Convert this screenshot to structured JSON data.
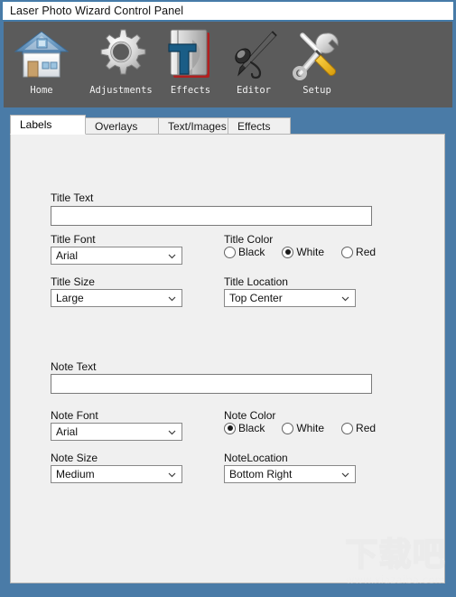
{
  "window": {
    "title": "Laser Photo Wizard Control Panel",
    "accent_border_color": "#4a7ba7",
    "toolbar_bg_color": "#5b5b5b",
    "panel_bg_color": "#f0f0f0"
  },
  "toolbar": {
    "items": [
      {
        "label": "Home",
        "icon": "house-icon"
      },
      {
        "label": "Adjustments",
        "icon": "gear-icon"
      },
      {
        "label": "Effects",
        "icon": "text-book-icon"
      },
      {
        "label": "Editor",
        "icon": "airbrush-icon"
      },
      {
        "label": "Setup",
        "icon": "wrench-screwdriver-icon"
      }
    ]
  },
  "tabs": [
    {
      "label": "Labels",
      "active": true
    },
    {
      "label": "Overlays",
      "active": false
    },
    {
      "label": "Text/Images",
      "active": false
    },
    {
      "label": "Effects",
      "active": false
    }
  ],
  "labels_tab": {
    "title_text": {
      "label": "Title Text",
      "value": "",
      "placeholder": ""
    },
    "title_font": {
      "label": "Title Font",
      "value": "Arial"
    },
    "title_color": {
      "label": "Title Color",
      "options": [
        {
          "label": "Black",
          "selected": false
        },
        {
          "label": "White",
          "selected": true
        },
        {
          "label": "Red",
          "selected": false
        }
      ]
    },
    "title_size": {
      "label": "Title Size",
      "value": "Large"
    },
    "title_location": {
      "label": "Title Location",
      "value": "Top Center"
    },
    "note_text": {
      "label": "Note Text",
      "value": "",
      "placeholder": ""
    },
    "note_font": {
      "label": "Note Font",
      "value": "Arial"
    },
    "note_color": {
      "label": "Note Color",
      "options": [
        {
          "label": "Black",
          "selected": true
        },
        {
          "label": "White",
          "selected": false
        },
        {
          "label": "Red",
          "selected": false
        }
      ]
    },
    "note_size": {
      "label": "Note Size",
      "value": "Medium"
    },
    "note_location": {
      "label": "NoteLocation",
      "value": "Bottom Right"
    }
  },
  "watermark": {
    "chinese": "下载吧",
    "url": "www.xiazaiba.com"
  }
}
